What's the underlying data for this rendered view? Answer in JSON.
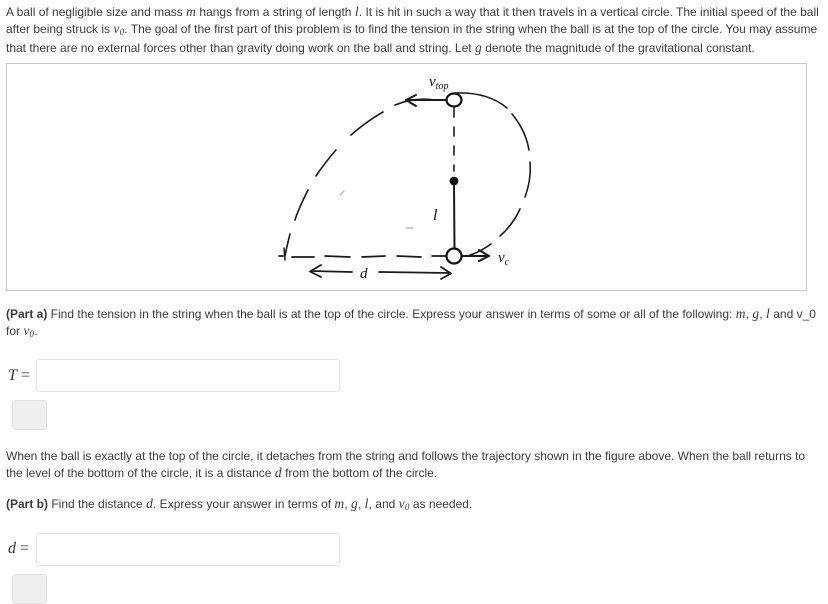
{
  "problem": {
    "intro_part1": "A ball of negligible size and mass ",
    "intro_var_m": "m",
    "intro_part2": " hangs from a string of length ",
    "intro_var_l": "l",
    "intro_part3": ". It is hit in such a way that it then travels in a vertical circle. The initial speed of the ball after being struck is ",
    "intro_var_v0": "v",
    "intro_var_v0_sub": "0",
    "intro_part4": ". The goal of the first part of this problem is to find the tension in the string when the ball is at the top of the circle. You may assume that there are no external forces other than gravity doing work on the ball and string. Let ",
    "intro_var_g": "g",
    "intro_part5": " denote the magnitude of the gravitational constant."
  },
  "figure": {
    "label_v_top": "v",
    "label_v_top_sub": "top",
    "label_v_c": "v",
    "label_v_c_sub": "c",
    "label_l": "l",
    "label_d": "d",
    "description": "hand-drawn vertical circle with dashed projectile trajectory, pivot point, string of length l, ball at bottom with velocity v_c, velocity v_top at top, horizontal distance d"
  },
  "part_a": {
    "label": "(Part a)",
    "text_1": " Find the tension in the string when the ball is at the top of the circle. Express your answer in terms of some or all of the following: ",
    "var_m": "m",
    "comma1": ", ",
    "var_g": "g",
    "comma2": ", ",
    "var_l": "l",
    "text_2": " and v_0 for ",
    "var_v0": "v",
    "var_v0_sub": "0",
    "period": ".",
    "answer_symbol": "T",
    "answer_equals": " =",
    "answer_value": "",
    "answer_placeholder": "",
    "submit_label": ""
  },
  "middle_text": {
    "line_1": "When the ball is exactly at the top of the circle, it detaches from the string and follows the trajectory shown in the figure above. When the ball returns to the level of the bottom of the circle, it is a distance ",
    "var_d": "d",
    "line_2": " from the bottom of the circle."
  },
  "part_b": {
    "label": "(Part b)",
    "text_1": " Find the distance ",
    "var_d": "d",
    "text_2": ". Express your answer in terms of ",
    "var_m": "m",
    "comma1": ", ",
    "var_g": "g",
    "comma2": ", ",
    "var_l": "l",
    "text_3": ", and ",
    "var_v0": "v",
    "var_v0_sub": "0",
    "text_4": " as needed.",
    "answer_symbol": "d",
    "answer_equals": " =",
    "answer_value": "",
    "answer_placeholder": "",
    "submit_label": ""
  },
  "colors": {
    "text": "#3a3a3a",
    "figure_border": "#c8c8c8",
    "input_border": "#e3e3e3",
    "button_bg": "#efefef",
    "ink": "#1a1a1a"
  }
}
